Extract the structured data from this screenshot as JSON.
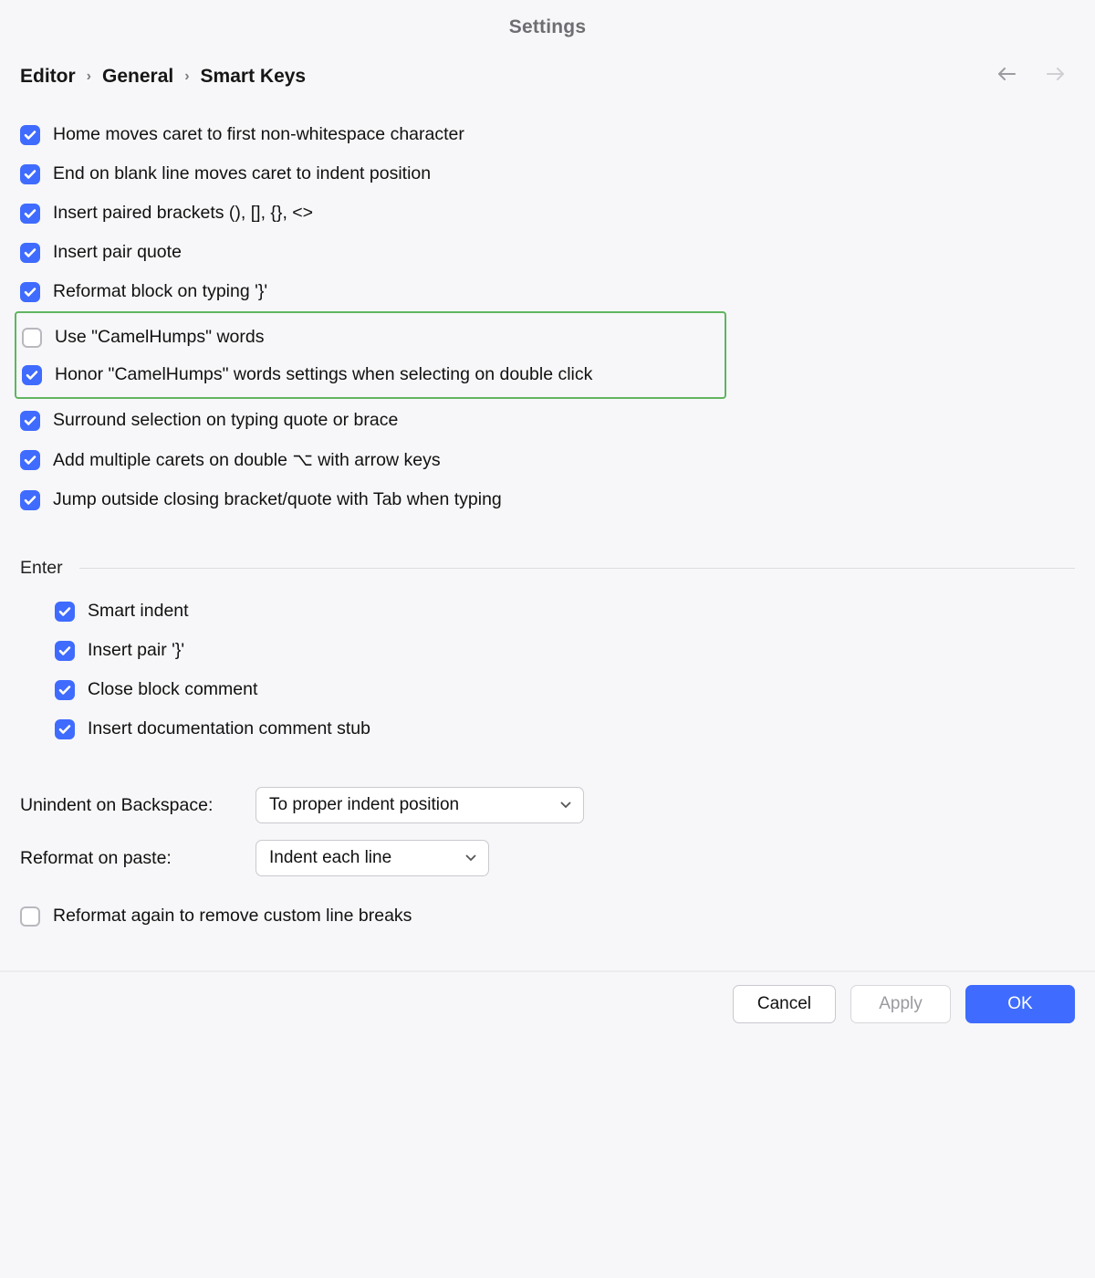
{
  "title": "Settings",
  "breadcrumbs": [
    "Editor",
    "General",
    "Smart Keys"
  ],
  "options_top": [
    {
      "id": "home-caret",
      "label": "Home moves caret to first non-whitespace character",
      "checked": true
    },
    {
      "id": "end-blank-line",
      "label": "End on blank line moves caret to indent position",
      "checked": true
    },
    {
      "id": "insert-paired-brackets",
      "label": "Insert paired brackets (), [], {}, <>",
      "checked": true
    },
    {
      "id": "insert-pair-quote",
      "label": "Insert pair quote",
      "checked": true
    },
    {
      "id": "reformat-on-brace",
      "label": "Reformat block on typing '}'",
      "checked": true
    }
  ],
  "highlighted": [
    {
      "id": "use-camelhumps",
      "label": "Use \"CamelHumps\" words",
      "checked": false
    },
    {
      "id": "honor-camelhumps",
      "label": "Honor \"CamelHumps\" words settings when selecting on double click",
      "checked": true
    }
  ],
  "options_after": [
    {
      "id": "surround-selection",
      "label": "Surround selection on typing quote or brace",
      "checked": true
    },
    {
      "id": "multi-caret-option",
      "label": "Add multiple carets on double ⌥ with arrow keys",
      "checked": true
    },
    {
      "id": "jump-outside",
      "label": "Jump outside closing bracket/quote with Tab when typing",
      "checked": true
    }
  ],
  "enter_section": {
    "title": "Enter",
    "items": [
      {
        "id": "smart-indent",
        "label": "Smart indent",
        "checked": true
      },
      {
        "id": "insert-pair-brace",
        "label": "Insert pair '}'",
        "checked": true
      },
      {
        "id": "close-block-comment",
        "label": "Close block comment",
        "checked": true
      },
      {
        "id": "insert-doc-stub",
        "label": "Insert documentation comment stub",
        "checked": true
      }
    ]
  },
  "selects": {
    "unindent_label": "Unindent on Backspace:",
    "unindent_value": "To proper indent position",
    "reformat_label": "Reformat on paste:",
    "reformat_value": "Indent each line"
  },
  "bottom_option": {
    "id": "reformat-again",
    "label": "Reformat again to remove custom line breaks",
    "checked": false
  },
  "footer": {
    "cancel": "Cancel",
    "apply": "Apply",
    "ok": "OK"
  }
}
